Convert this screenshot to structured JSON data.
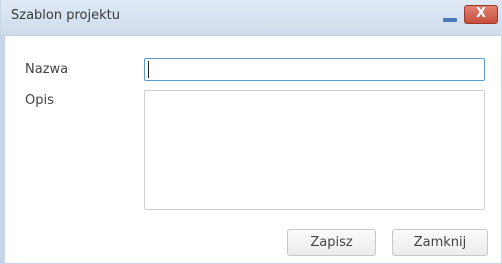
{
  "dialog": {
    "title": "Szablon projektu",
    "close_glyph": "X",
    "minimize_icon": "minimize-icon"
  },
  "form": {
    "name_label": "Nazwa",
    "name_value": "",
    "description_label": "Opis",
    "description_value": ""
  },
  "buttons": {
    "save_label": "Zapisz",
    "close_label": "Zamknij"
  },
  "colors": {
    "titlebar": "#d8e4f2",
    "focus_border": "#5b9bd5",
    "close_button": "#d0604c"
  }
}
